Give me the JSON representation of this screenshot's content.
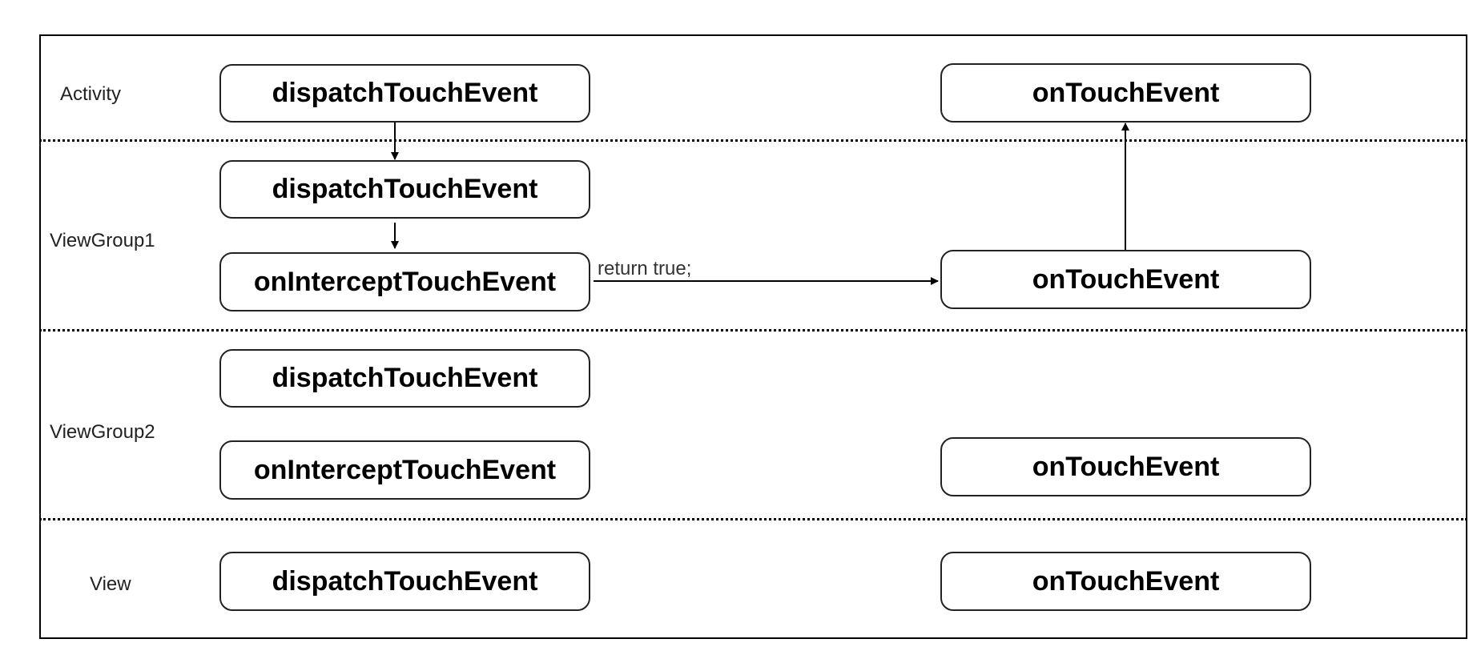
{
  "layers": [
    {
      "name": "Activity"
    },
    {
      "name": "ViewGroup1"
    },
    {
      "name": "ViewGroup2"
    },
    {
      "name": "View"
    }
  ],
  "nodes": {
    "activity_dispatch": "dispatchTouchEvent",
    "activity_ontouch": "onTouchEvent",
    "vg1_dispatch": "dispatchTouchEvent",
    "vg1_intercept": "onInterceptTouchEvent",
    "vg1_ontouch": "onTouchEvent",
    "vg2_dispatch": "dispatchTouchEvent",
    "vg2_intercept": "onInterceptTouchEvent",
    "vg2_ontouch": "onTouchEvent",
    "view_dispatch": "dispatchTouchEvent",
    "view_ontouch": "onTouchEvent"
  },
  "edges": [
    {
      "from": "activity_dispatch",
      "to": "vg1_dispatch",
      "label": ""
    },
    {
      "from": "vg1_dispatch",
      "to": "vg1_intercept",
      "label": ""
    },
    {
      "from": "vg1_intercept",
      "to": "vg1_ontouch",
      "label": "return true;"
    },
    {
      "from": "vg1_ontouch",
      "to": "activity_ontouch",
      "label": ""
    }
  ]
}
